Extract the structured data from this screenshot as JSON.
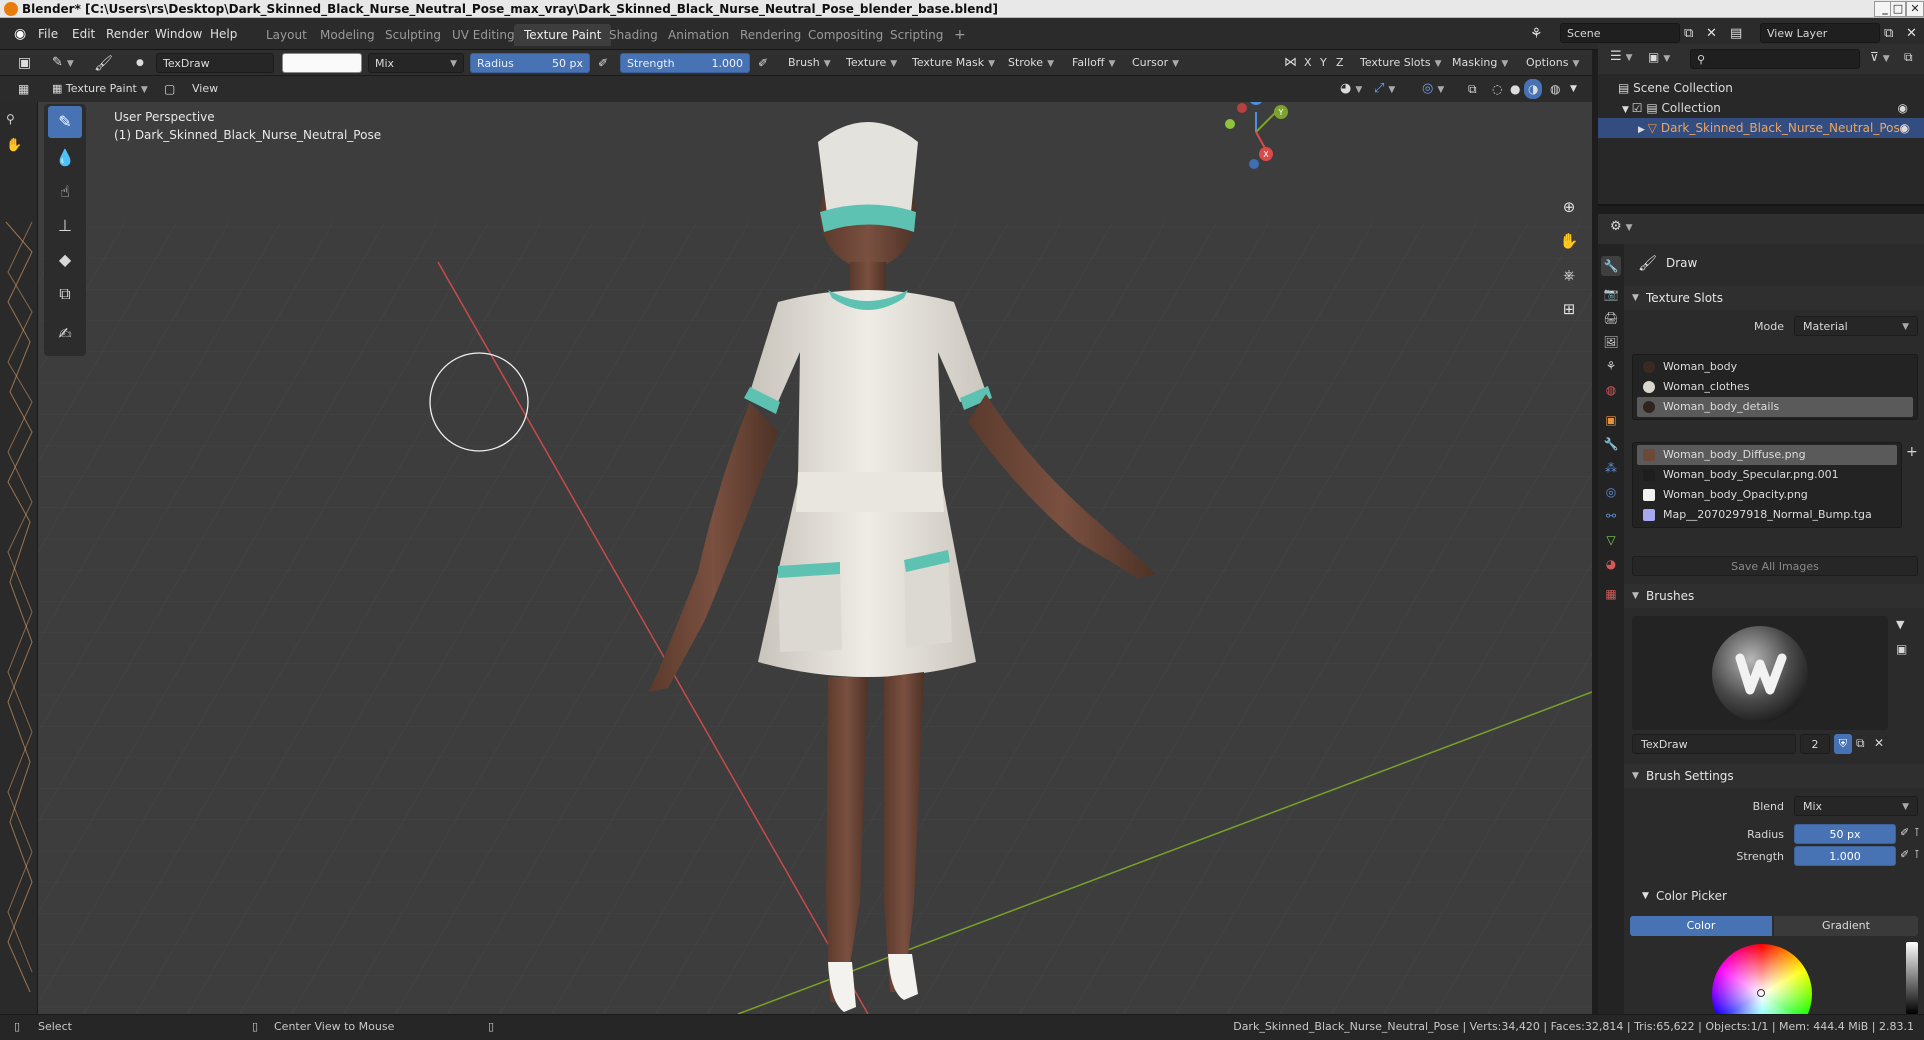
{
  "window": {
    "title": "Blender* [C:\\Users\\rs\\Desktop\\Dark_Skinned_Black_Nurse_Neutral_Pose_max_vray\\Dark_Skinned_Black_Nurse_Neutral_Pose_blender_base.blend]",
    "minimize": "_",
    "maximize": "□",
    "close": "✕"
  },
  "menu": [
    "File",
    "Edit",
    "Render",
    "Window",
    "Help"
  ],
  "workspaces": [
    "Layout",
    "Modeling",
    "Sculpting",
    "UV Editing",
    "Texture Paint",
    "Shading",
    "Animation",
    "Rendering",
    "Compositing",
    "Scripting",
    "+"
  ],
  "active_workspace_index": 4,
  "scene": {
    "name": "Scene",
    "view_layer": "View Layer"
  },
  "toolheader": {
    "brush_name": "TexDraw",
    "blend": "Mix",
    "radius_label": "Radius",
    "radius_value": "50 px",
    "strength_label": "Strength",
    "strength_value": "1.000",
    "brush": "Brush",
    "texture": "Texture",
    "texture_mask": "Texture Mask",
    "stroke": "Stroke",
    "falloff": "Falloff",
    "cursor": "Cursor",
    "x": "X",
    "y": "Y",
    "z": "Z",
    "texture_slots": "Texture Slots",
    "masking": "Masking",
    "options": "Options"
  },
  "modeheader": {
    "mode": "Texture Paint",
    "view": "View"
  },
  "viewport": {
    "perspective": "User Perspective",
    "object_label": "(1) Dark_Skinned_Black_Nurse_Neutral_Pose",
    "gizmo": {
      "x": "X",
      "y": "Y",
      "z": "Z"
    }
  },
  "outliner": {
    "scene_collection": "Scene Collection",
    "collection": "Collection",
    "object": "Dark_Skinned_Black_Nurse_Neutral_Pose"
  },
  "properties": {
    "tool_name": "Draw",
    "texture_slots_title": "Texture Slots",
    "mode_label": "Mode",
    "mode_value": "Material",
    "materials": [
      {
        "name": "Woman_body",
        "color": "#3a2a22"
      },
      {
        "name": "Woman_clothes",
        "color": "#d9d6cf"
      },
      {
        "name": "Woman_body_details",
        "color": "#2f2420"
      }
    ],
    "images": [
      {
        "name": "Woman_body_Diffuse.png",
        "color": "#6b4a3a"
      },
      {
        "name": "Woman_body_Specular.png.001",
        "color": "#1e1e1e"
      },
      {
        "name": "Woman_body_Opacity.png",
        "color": "#f2f2f2"
      },
      {
        "name": "Map__2070297918_Normal_Bump.tga",
        "color": "#a8a8f0"
      }
    ],
    "save_all": "Save All Images",
    "brushes_title": "Brushes",
    "brush_name": "TexDraw",
    "brush_users": "2",
    "brush_settings_title": "Brush Settings",
    "blend_label": "Blend",
    "blend_value": "Mix",
    "radius_label": "Radius",
    "radius_value": "50 px",
    "strength_label": "Strength",
    "strength_value": "1.000",
    "color_picker_title": "Color Picker",
    "color_tab": "Color",
    "gradient_tab": "Gradient"
  },
  "status": {
    "select": "Select",
    "center_view": "Center View to Mouse",
    "stats": "Dark_Skinned_Black_Nurse_Neutral_Pose | Verts:34,420 | Faces:32,814 | Tris:65,622 | Objects:1/1 | Mem: 444.4 MiB | 2.83.1"
  }
}
